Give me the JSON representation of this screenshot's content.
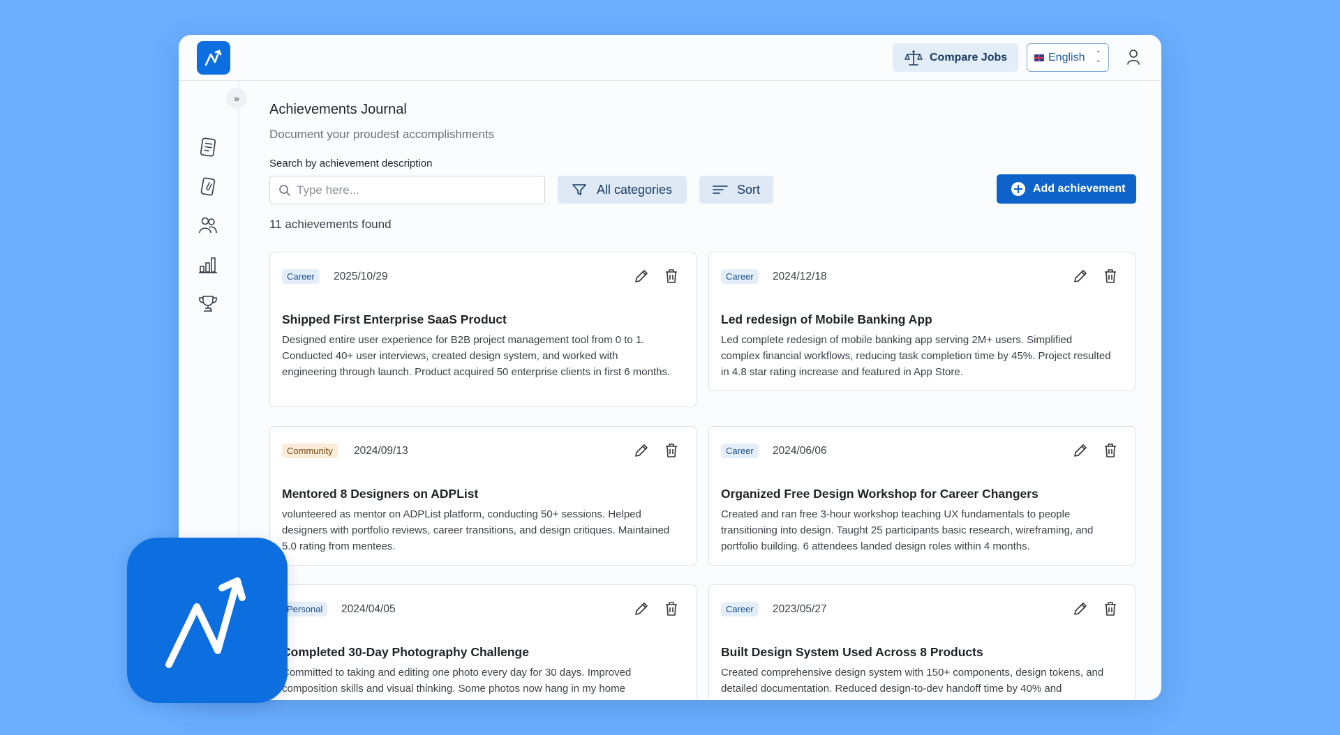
{
  "header": {
    "compare_jobs_label": "Compare Jobs",
    "language_label": "English"
  },
  "sidebar": {
    "items": [
      {
        "icon": "document-list-icon"
      },
      {
        "icon": "clipboard-attachment-icon"
      },
      {
        "icon": "people-icon"
      },
      {
        "icon": "bar-chart-icon"
      },
      {
        "icon": "trophy-icon"
      }
    ]
  },
  "page": {
    "title": "Achievements Journal",
    "subtitle": "Document your proudest accomplishments",
    "search_label": "Search by achievement description",
    "search_placeholder": "Type here...",
    "categories_label": "All categories",
    "sort_label": "Sort",
    "add_label": "Add achievement",
    "count_text": "11 achievements found"
  },
  "cards": [
    {
      "category": "Career",
      "date": "2025/10/29",
      "title": "Shipped First Enterprise SaaS Product",
      "description": "Designed entire user experience for B2B project management tool from 0 to 1. Conducted 40+ user interviews, created design system, and worked with engineering through launch. Product acquired 50 enterprise clients in first 6 months."
    },
    {
      "category": "Career",
      "date": "2024/12/18",
      "title": "Led redesign of Mobile Banking App",
      "description": "Led complete redesign of mobile banking app serving 2M+ users. Simplified complex financial workflows, reducing task completion time by 45%. Project resulted in 4.8 star rating increase and featured in App Store."
    },
    {
      "category": "Community",
      "date": "2024/09/13",
      "title": "Mentored 8 Designers on ADPList",
      "description": "volunteered as mentor on ADPList platform, conducting 50+ sessions. Helped designers with portfolio reviews, career transitions, and design critiques. Maintained 5.0 rating from mentees."
    },
    {
      "category": "Career",
      "date": "2024/06/06",
      "title": "Organized Free Design Workshop for Career Changers",
      "description": "Created and ran free 3-hour workshop teaching UX fundamentals to people transitioning into design. Taught 25 participants basic research, wireframing, and portfolio building. 6 attendees landed design roles within 4 months."
    },
    {
      "category": "Personal",
      "date": "2024/04/05",
      "title": "Completed 30-Day Photography Challenge",
      "description": "Committed to taking and editing one photo every day for 30 days. Improved composition skills and visual thinking. Some photos now hang in my home"
    },
    {
      "category": "Career",
      "date": "2023/05/27",
      "title": "Built Design System Used Across 8 Products",
      "description": "Created comprehensive design system with 150+ components, design tokens, and detailed documentation. Reduced design-to-dev handoff time by 40% and"
    }
  ],
  "colors": {
    "background": "#6aaefd",
    "brand": "#0d6ee0",
    "primary_button": "#0d63c9"
  }
}
